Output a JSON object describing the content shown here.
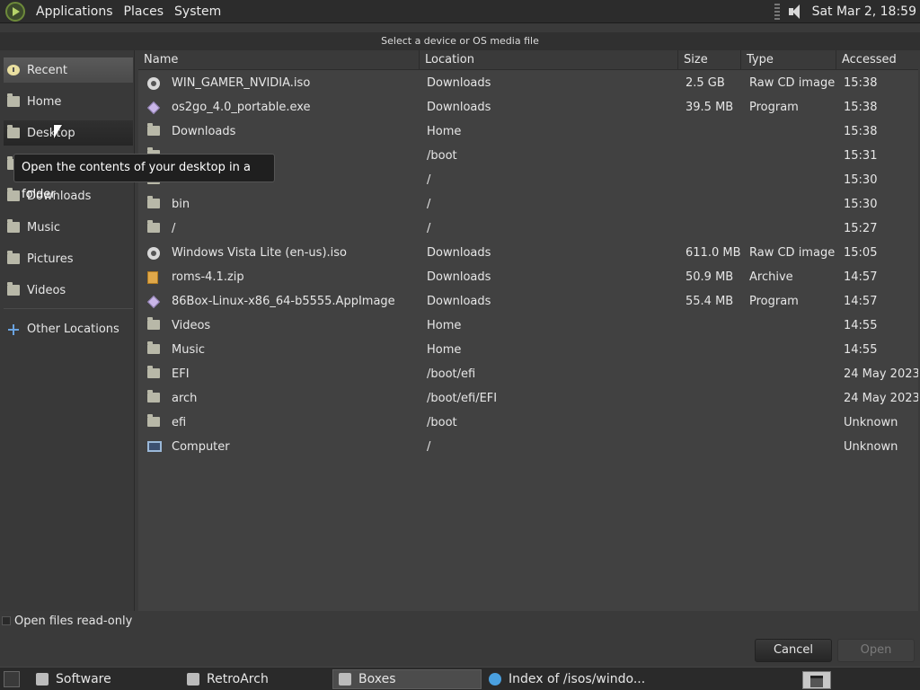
{
  "top_panel": {
    "menus": [
      "Applications",
      "Places",
      "System"
    ],
    "clock": "Sat Mar  2, 18:59"
  },
  "dialog": {
    "title": "Select a device or OS media file"
  },
  "sidebar": {
    "items": [
      {
        "label": "Recent",
        "icon": "recent-icon"
      },
      {
        "label": "Home",
        "icon": "folder-icon"
      },
      {
        "label": "Desktop",
        "icon": "folder-icon"
      },
      {
        "label": "",
        "icon": "folder-icon"
      },
      {
        "label": "Downloads",
        "icon": "folder-icon"
      },
      {
        "label": "Music",
        "icon": "folder-icon"
      },
      {
        "label": "Pictures",
        "icon": "folder-icon"
      },
      {
        "label": "Videos",
        "icon": "folder-icon"
      }
    ],
    "other_locations": "Other Locations"
  },
  "tooltip": "Open the contents of your desktop in a folder",
  "columns": {
    "name": "Name",
    "location": "Location",
    "size": "Size",
    "type": "Type",
    "accessed": "Accessed"
  },
  "files": [
    {
      "name": "WIN_GAMER_NVIDIA.iso",
      "location": "Downloads",
      "size": "2.5 GB",
      "type": "Raw CD image",
      "accessed": "15:38",
      "icon": "disc-icon"
    },
    {
      "name": "os2go_4.0_portable.exe",
      "location": "Downloads",
      "size": "39.5 MB",
      "type": "Program",
      "accessed": "15:38",
      "icon": "executable-icon"
    },
    {
      "name": "Downloads",
      "location": "Home",
      "size": "",
      "type": "",
      "accessed": "15:38",
      "icon": "folder-icon"
    },
    {
      "name": "",
      "location": "/boot",
      "size": "",
      "type": "",
      "accessed": "15:31",
      "icon": "folder-icon"
    },
    {
      "name": "",
      "location": "/",
      "size": "",
      "type": "",
      "accessed": "15:30",
      "icon": "folder-icon"
    },
    {
      "name": "bin",
      "location": "/",
      "size": "",
      "type": "",
      "accessed": "15:30",
      "icon": "folder-icon"
    },
    {
      "name": "/",
      "location": "/",
      "size": "",
      "type": "",
      "accessed": "15:27",
      "icon": "folder-icon"
    },
    {
      "name": "Windows Vista Lite (en-us).iso",
      "location": "Downloads",
      "size": "611.0 MB",
      "type": "Raw CD image",
      "accessed": "15:05",
      "icon": "disc-icon"
    },
    {
      "name": "roms-4.1.zip",
      "location": "Downloads",
      "size": "50.9 MB",
      "type": "Archive",
      "accessed": "14:57",
      "icon": "archive-icon"
    },
    {
      "name": "86Box-Linux-x86_64-b5555.AppImage",
      "location": "Downloads",
      "size": "55.4 MB",
      "type": "Program",
      "accessed": "14:57",
      "icon": "executable-icon"
    },
    {
      "name": "Videos",
      "location": "Home",
      "size": "",
      "type": "",
      "accessed": "14:55",
      "icon": "folder-icon"
    },
    {
      "name": "Music",
      "location": "Home",
      "size": "",
      "type": "",
      "accessed": "14:55",
      "icon": "folder-icon"
    },
    {
      "name": "EFI",
      "location": "/boot/efi",
      "size": "",
      "type": "",
      "accessed": "24 May 2023",
      "icon": "folder-icon"
    },
    {
      "name": "arch",
      "location": "/boot/efi/EFI",
      "size": "",
      "type": "",
      "accessed": "24 May 2023",
      "icon": "folder-icon"
    },
    {
      "name": "efi",
      "location": "/boot",
      "size": "",
      "type": "",
      "accessed": "Unknown",
      "icon": "folder-icon"
    },
    {
      "name": "Computer",
      "location": "/",
      "size": "",
      "type": "",
      "accessed": "Unknown",
      "icon": "computer-icon"
    }
  ],
  "footer": {
    "read_only_label": "Open files read-only",
    "cancel": "Cancel",
    "open": "Open"
  },
  "taskbar": {
    "tasks": [
      {
        "label": "Software",
        "icon": "software-icon"
      },
      {
        "label": "RetroArch",
        "icon": "retroarch-icon"
      },
      {
        "label": "Boxes",
        "icon": "boxes-icon"
      },
      {
        "label": "Index of /isos/windo...",
        "icon": "globe-icon"
      }
    ]
  },
  "colors": {
    "panel": "#2c2c2c",
    "background": "#414141",
    "selected": "#5a5a5a"
  }
}
